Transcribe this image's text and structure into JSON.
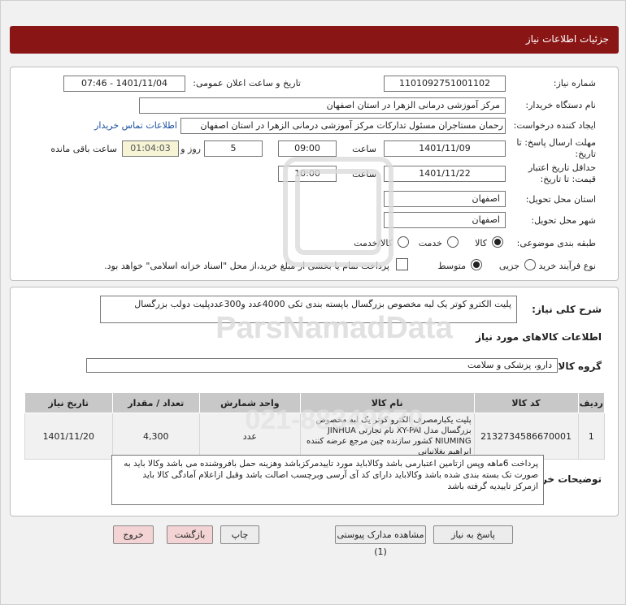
{
  "header": {
    "title": "جزئیات اطلاعات نیاز"
  },
  "form": {
    "need_number_label": "شماره نیاز:",
    "need_number": "1101092751001102",
    "announce_label": "تاریخ و ساعت اعلان عمومی:",
    "announce_value": "1401/11/04 - 07:46",
    "buyer_label": "نام دستگاه خریدار:",
    "buyer_value": "مرکز آموزشی درمانی الزهرا در استان اصفهان",
    "creator_label": "ایجاد کننده درخواست:",
    "creator_value": "رحمان مستاجران مسئول تدارکات مرکز آموزشی درمانی الزهرا در استان اصفهان",
    "contact_link": "اطلاعات تماس خریدار",
    "deadline_label_1": "مهلت ارسال پاسخ: تا",
    "deadline_label_2": "تاریخ:",
    "deadline_date": "1401/11/09",
    "time_label": "ساعت",
    "deadline_time": "09:00",
    "days_value": "5",
    "days_label": "روز و",
    "remaining_time": "01:04:03",
    "remaining_label": "ساعت باقی مانده",
    "validity_label_1": "حداقل تاریخ اعتبار",
    "validity_label_2": "قیمت: تا تاریخ:",
    "validity_date": "1401/11/22",
    "validity_time": "10:00",
    "province_label": "استان محل تحویل:",
    "province_value": "اصفهان",
    "city_label": "شهر محل تحویل:",
    "city_value": "اصفهان",
    "category_label": "طبقه بندی موضوعی:",
    "category_options": [
      "کالا",
      "خدمت",
      "کالا/خدمت"
    ],
    "category_selected": "کالا",
    "purchase_label": "نوع فرآیند خرید :",
    "purchase_options": [
      "جزیی",
      "متوسط"
    ],
    "purchase_selected": "متوسط",
    "payment_note": "پرداخت تمام یا بخشی از مبلغ خرید،از محل \"اسناد خزانه اسلامی\" خواهد بود."
  },
  "details": {
    "summary_label": "شرح کلی نیاز:",
    "summary_value": "پلیت  الکترو کوتر یک لبه مخصوص بزرگسال باپسته بندی تکی 4000عدد و300عددپلیت دولب بزرگسال",
    "goods_info_title": "اطلاعات کالاهای مورد نیاز",
    "goods_group_label": "گروه کالا:",
    "goods_group_value": "دارو، پزشکی و سلامت",
    "table": {
      "headers": [
        "ردیف",
        "کد کالا",
        "نام کالا",
        "واحد شمارش",
        "تعداد / مقدار",
        "تاریخ نیاز"
      ],
      "rows": [
        {
          "row": "1",
          "code": "2132734586670001",
          "name": "پلیت یکبارمصرف الکترو کوتر یک لبه مخصوص بزرگسال مدل XY-PAI نام تجارتی JINHUA NIUMING کشور سازنده چین مرجع عرضه کننده ابراهیم بغلانیانی",
          "unit": "عدد",
          "qty": "4,300",
          "date": "1401/11/20"
        }
      ]
    },
    "buyer_notes_label": "توضیحات خریدار:",
    "buyer_notes": "پرداخت 6ماهه وپس ازتامین اعتبارمی باشد وکالاباید مورد تاییدمرکزباشد وهزینه حمل بافروشنده می باشد وکالا باید به صورت تک بسته بندی شده باشد وکالاباید دارای کد آی آرسی وبرچسب اصالت باشد وقبل ازاعلام آمادگی کالا باید ازمرکز تاییدیه گرفته باشد"
  },
  "buttons": {
    "reply": "پاسخ به نیاز",
    "attachments": "مشاهده مدارک پیوستی (1)",
    "print": "چاپ",
    "back": "بازگشت",
    "exit": "خروج"
  },
  "watermark": {
    "text_en": "ParsNamadData",
    "number": "021-88349670"
  },
  "colors": {
    "header_bg": "#8a1515",
    "link": "#1a4fa3",
    "remaining_bg": "#f7f3d5"
  }
}
